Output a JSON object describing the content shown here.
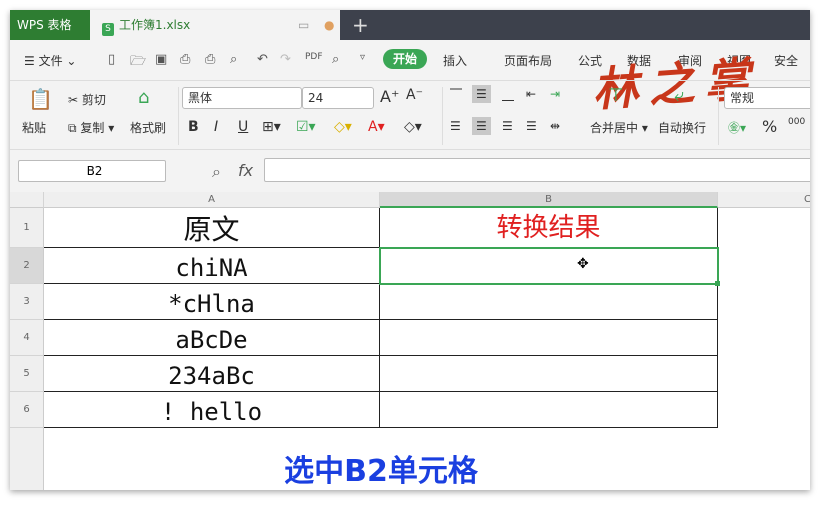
{
  "title_bar": {
    "app_tab": "WPS 表格",
    "doc_tab": "工作簿1.xlsx",
    "doc_icon": "S",
    "new_tab": "+"
  },
  "menu": {
    "file": "文件",
    "items": [
      "开始",
      "插入",
      "页面布局",
      "公式",
      "数据",
      "审阅",
      "视图",
      "安全"
    ]
  },
  "ribbon": {
    "paste": "粘贴",
    "cut": "剪切",
    "copy": "复制",
    "format_painter": "格式刷",
    "font_name": "黑体",
    "font_size": "24",
    "merge_center": "合并居中",
    "wrap_text": "自动换行",
    "number_format": "常规"
  },
  "formula_bar": {
    "name_box": "B2",
    "fx": "fx",
    "formula": ""
  },
  "sheet": {
    "columns": [
      "A",
      "B",
      "C"
    ],
    "rows": [
      "1",
      "2",
      "3",
      "4",
      "5",
      "6"
    ],
    "cells": {
      "A": [
        "原文",
        "chiNA",
        "*cHlna",
        "aBcDe",
        "234aBc",
        "! hello"
      ],
      "B1": "转换结果"
    },
    "selected": "B2"
  },
  "caption": "选中B2单元格",
  "watermark": "林之掌",
  "colors": {
    "accent": "#3aa655",
    "header_red": "#e02020",
    "caption_blue": "#1a3fe0"
  }
}
